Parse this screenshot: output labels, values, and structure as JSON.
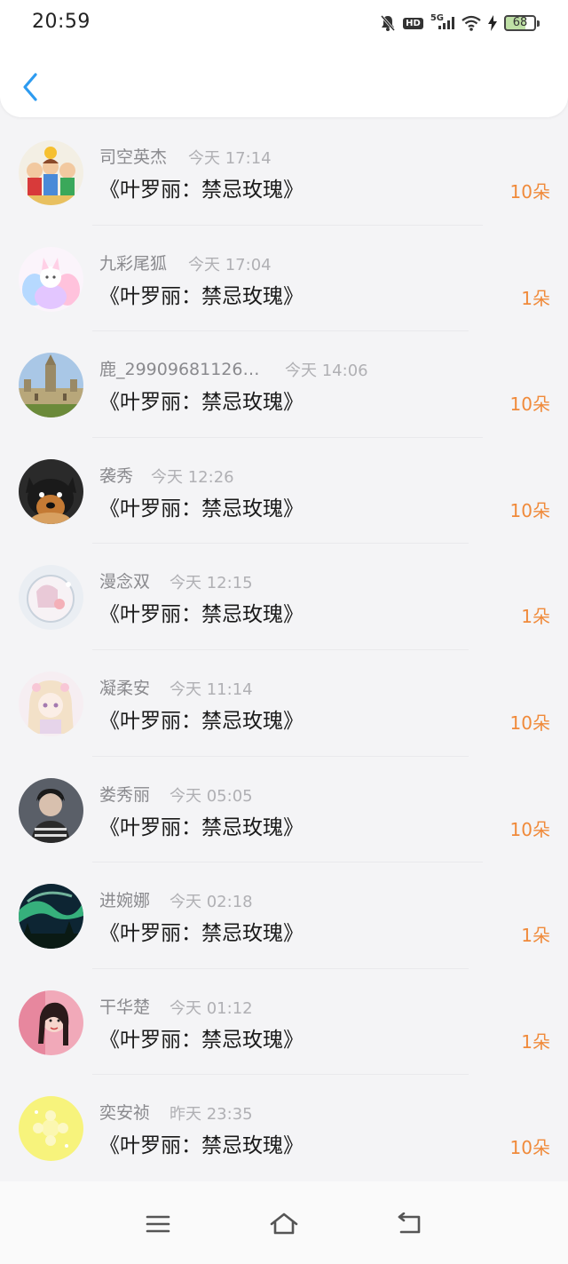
{
  "status_bar": {
    "time": "20:59",
    "network": "5G",
    "hd_label": "HD",
    "battery_level": "68",
    "icons": [
      "bell-muted-icon",
      "hd-icon",
      "signal-5g-icon",
      "wifi-icon",
      "charging-icon",
      "battery-icon"
    ]
  },
  "header": {
    "back_icon": "chevron-left-icon"
  },
  "gifts": [
    {
      "name": "司空英杰",
      "time": "今天 17:14",
      "title": "《叶罗丽：禁忌玫瑰》",
      "count": "10朵",
      "avatar_style": "cartoon-group"
    },
    {
      "name": "九彩尾狐",
      "time": "今天 17:04",
      "title": "《叶罗丽：禁忌玫瑰》",
      "count": "1朵",
      "avatar_style": "pastel-fox"
    },
    {
      "name": "鹿_29909681126…",
      "time": "今天 14:06",
      "title": "《叶罗丽：禁忌玫瑰》",
      "count": "10朵",
      "avatar_style": "gothic-building"
    },
    {
      "name": "袭秀",
      "time": "今天 12:26",
      "title": "《叶罗丽：禁忌玫瑰》",
      "count": "10朵",
      "avatar_style": "dog"
    },
    {
      "name": "漫念双",
      "time": "今天 12:15",
      "title": "《叶罗丽：禁忌玫瑰》",
      "count": "1朵",
      "avatar_style": "anime-bubble"
    },
    {
      "name": "凝柔安",
      "time": "今天 11:14",
      "title": "《叶罗丽：禁忌玫瑰》",
      "count": "10朵",
      "avatar_style": "anime-girl"
    },
    {
      "name": "娄秀丽",
      "time": "今天 05:05",
      "title": "《叶罗丽：禁忌玫瑰》",
      "count": "10朵",
      "avatar_style": "person-dark"
    },
    {
      "name": "进婉娜",
      "time": "今天 02:18",
      "title": "《叶罗丽：禁忌玫瑰》",
      "count": "1朵",
      "avatar_style": "aurora"
    },
    {
      "name": "干华楚",
      "time": "今天 01:12",
      "title": "《叶罗丽：禁忌玫瑰》",
      "count": "1朵",
      "avatar_style": "girl-pink"
    },
    {
      "name": "奕安祯",
      "time": "昨天 23:35",
      "title": "《叶罗丽：禁忌玫瑰》",
      "count": "10朵",
      "avatar_style": "yellow-flower"
    }
  ],
  "nav_bar": {
    "icons": [
      "menu-icon",
      "home-icon",
      "back-nav-icon"
    ]
  },
  "colors": {
    "accent_blue": "#2d9bf0",
    "count_orange": "#f08a3a",
    "name_gray": "#8a8a8e"
  }
}
